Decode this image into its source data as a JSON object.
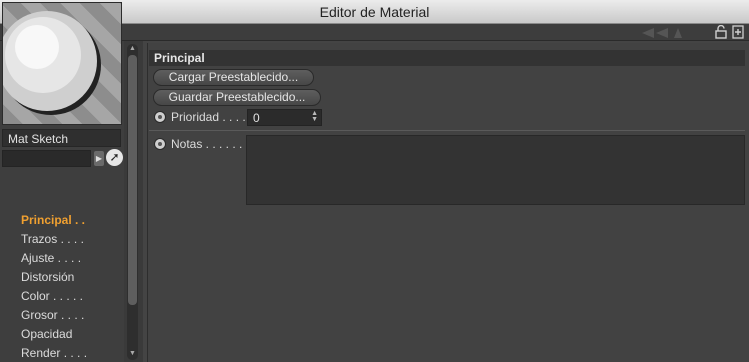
{
  "window": {
    "title": "Editor de Material"
  },
  "material": {
    "name": "Mat Sketch"
  },
  "nav": {
    "items": [
      {
        "label": "Principal . .",
        "active": true
      },
      {
        "label": "Trazos . . . .",
        "active": false
      },
      {
        "label": "Ajuste . . . .",
        "active": false
      },
      {
        "label": "Distorsión",
        "active": false
      },
      {
        "label": "Color . . . . .",
        "active": false
      },
      {
        "label": "Grosor . . . .",
        "active": false
      },
      {
        "label": "Opacidad",
        "active": false
      },
      {
        "label": "Render . . . .",
        "active": false
      }
    ]
  },
  "section": {
    "title": "Principal",
    "load_preset_label": "Cargar Preestablecido...",
    "save_preset_label": "Guardar Preestablecido...",
    "priority_label": "Prioridad . . . .",
    "priority_value": "0",
    "notes_label": "Notas . . . . . . .",
    "notes_value": ""
  },
  "colors": {
    "active_nav": "#f0a030",
    "background": "#444444"
  },
  "icons": [
    "grip-icon",
    "lock-icon",
    "new-window-icon",
    "cursor-icon"
  ]
}
